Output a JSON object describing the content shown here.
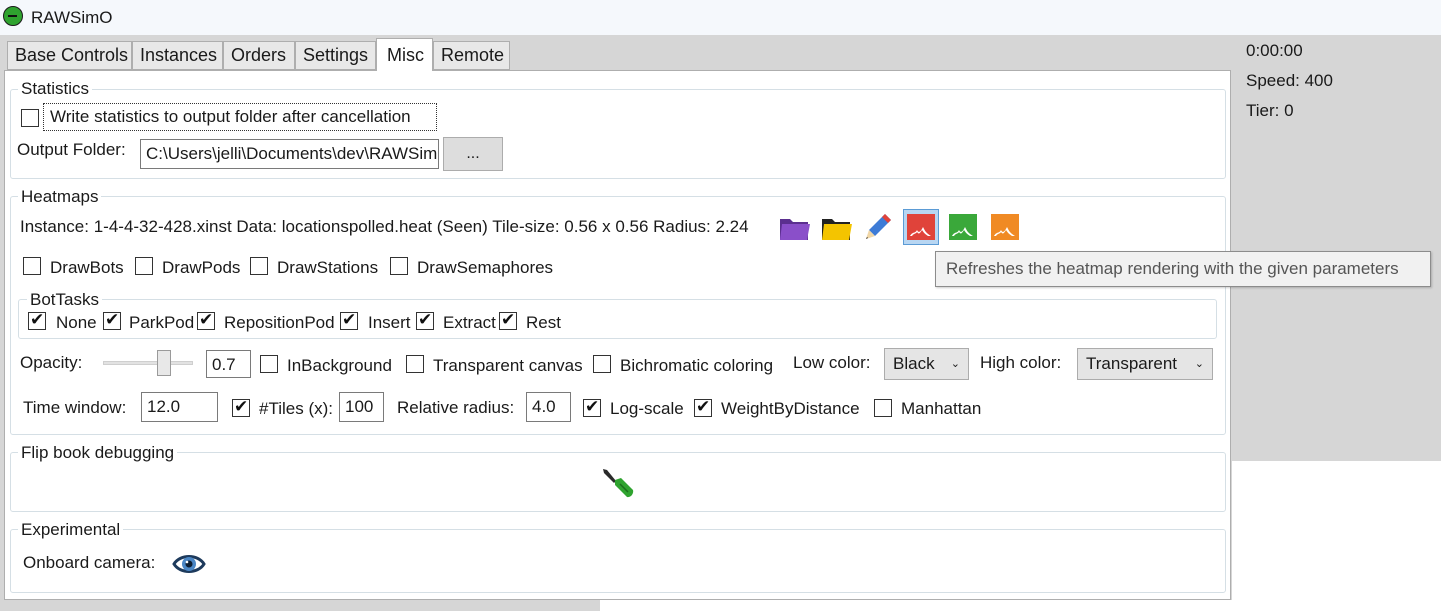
{
  "app": {
    "title": "RAWSimO"
  },
  "status": {
    "time": "0:00:00",
    "speed": "Speed: 400",
    "tier": "Tier: 0"
  },
  "tabs": [
    {
      "label": "Base Controls"
    },
    {
      "label": "Instances"
    },
    {
      "label": "Orders"
    },
    {
      "label": "Settings"
    },
    {
      "label": "Misc"
    },
    {
      "label": "Remote"
    }
  ],
  "statistics": {
    "legend": "Statistics",
    "write_stats_label": "Write statistics to output folder after cancellation",
    "output_folder_label": "Output Folder:",
    "output_folder_value": "C:\\Users\\jelli\\Documents\\dev\\RAWSim",
    "browse_label": "..."
  },
  "heatmaps": {
    "legend": "Heatmaps",
    "info": "Instance: 1-4-4-32-428.xinst Data: locationspolled.heat (Seen) Tile-size: 0.56 x 0.56 Radius: 2.24",
    "tooltip": "Refreshes the heatmap rendering with the given parameters",
    "draw_options": [
      {
        "label": "DrawBots",
        "checked": false
      },
      {
        "label": "DrawPods",
        "checked": false
      },
      {
        "label": "DrawStations",
        "checked": false
      },
      {
        "label": "DrawSemaphores",
        "checked": false
      }
    ],
    "bottasks_legend": "BotTasks",
    "bottasks": [
      {
        "label": "None",
        "checked": true
      },
      {
        "label": "ParkPod",
        "checked": true
      },
      {
        "label": "RepositionPod",
        "checked": true
      },
      {
        "label": "Insert",
        "checked": true
      },
      {
        "label": "Extract",
        "checked": true
      },
      {
        "label": "Rest",
        "checked": true
      }
    ],
    "opacity_label": "Opacity:",
    "opacity_value": "0.7",
    "in_background_label": "InBackground",
    "transparent_canvas_label": "Transparent canvas",
    "bichromatic_label": "Bichromatic coloring",
    "low_color_label": "Low color:",
    "low_color_value": "Black",
    "high_color_label": "High color:",
    "high_color_value": "Transparent",
    "time_window_label": "Time window:",
    "time_window_value": "12.0",
    "tiles_label": "#Tiles (x):",
    "tiles_value": "100",
    "relative_radius_label": "Relative radius:",
    "relative_radius_value": "4.0",
    "log_scale_label": "Log-scale",
    "weight_by_distance_label": "WeightByDistance",
    "manhattan_label": "Manhattan"
  },
  "flipbook": {
    "legend": "Flip book debugging"
  },
  "experimental": {
    "legend": "Experimental",
    "camera_label": "Onboard camera:"
  },
  "colors": {
    "accent_selected": "#b8d6f2",
    "folder_purple": "#8a4fc9",
    "folder_yellow": "#f4c400",
    "heat_red": "#e0433a",
    "heat_green": "#3aa83a",
    "heat_orange": "#f08a24"
  }
}
